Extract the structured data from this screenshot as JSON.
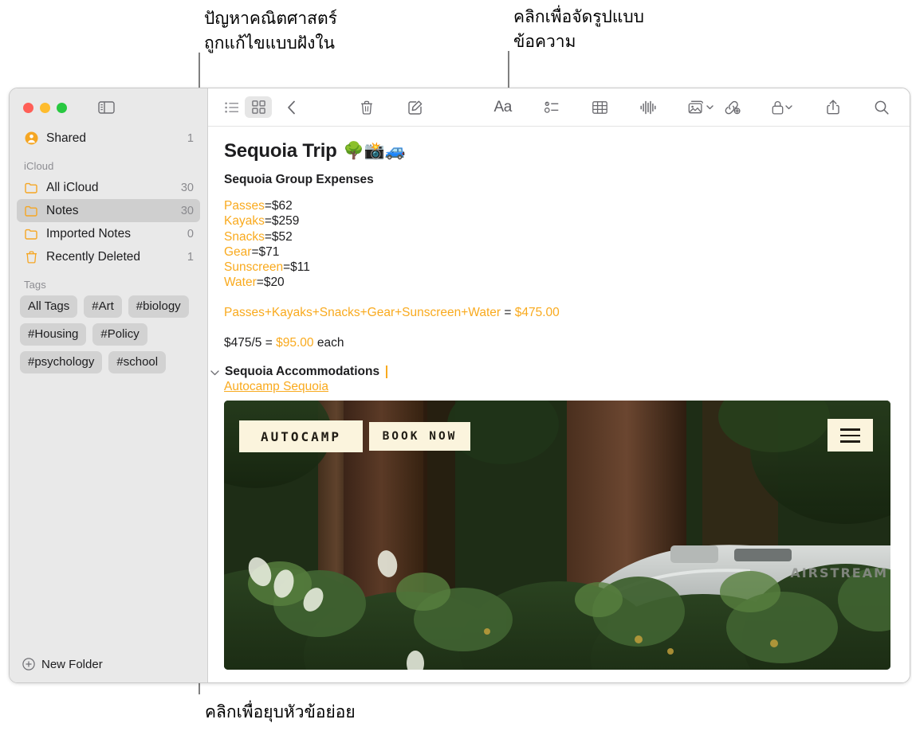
{
  "callouts": {
    "top_left": "ปัญหาคณิตศาสตร์\nถูกแก้ไขแบบฝังใน",
    "top_right": "คลิกเพื่อจัดรูปแบบ\nข้อความ",
    "bottom": "คลิกเพื่อยุบหัวข้อย่อย"
  },
  "sidebar": {
    "window_controls": [
      "close",
      "minimize",
      "zoom"
    ],
    "toggle_icon": "sidebar-toggle-icon",
    "shared": {
      "label": "Shared",
      "count": "1",
      "icon": "shared-person-icon"
    },
    "icloud_header": "iCloud",
    "folders": [
      {
        "label": "All iCloud",
        "count": "30",
        "icon": "folder-icon",
        "selected": false
      },
      {
        "label": "Notes",
        "count": "30",
        "icon": "folder-icon",
        "selected": true
      },
      {
        "label": "Imported Notes",
        "count": "0",
        "icon": "folder-icon",
        "selected": false
      },
      {
        "label": "Recently Deleted",
        "count": "1",
        "icon": "trash-icon",
        "selected": false
      }
    ],
    "tags_header": "Tags",
    "tags": [
      "All Tags",
      "#Art",
      "#biology",
      "#Housing",
      "#Policy",
      "#psychology",
      "#school"
    ],
    "new_folder": {
      "label": "New Folder",
      "icon": "plus-circle-icon"
    }
  },
  "toolbar": {
    "items": [
      {
        "name": "list-view-icon",
        "label": "List View"
      },
      {
        "name": "gallery-view-icon",
        "label": "Gallery View",
        "active": true
      },
      {
        "name": "back-chevron-icon",
        "label": "Back"
      },
      {
        "name": "trash-icon",
        "label": "Delete"
      },
      {
        "name": "compose-icon",
        "label": "New Note"
      },
      {
        "name": "format-aa-icon",
        "label": "Aa"
      },
      {
        "name": "checklist-icon",
        "label": "Checklist"
      },
      {
        "name": "table-icon",
        "label": "Table"
      },
      {
        "name": "audio-waveform-icon",
        "label": "Audio"
      },
      {
        "name": "media-icon",
        "label": "Media"
      },
      {
        "name": "link-icon",
        "label": "Add Link"
      },
      {
        "name": "lock-icon",
        "label": "Lock Note"
      },
      {
        "name": "share-icon",
        "label": "Share"
      },
      {
        "name": "search-icon",
        "label": "Search"
      }
    ],
    "aa_label": "Aa"
  },
  "note": {
    "title": "Sequoia Trip",
    "title_emoji": "🌳📸🚙",
    "subheading": "Sequoia Group Expenses",
    "expenses": [
      {
        "name": "Passes",
        "value": "=$62"
      },
      {
        "name": "Kayaks",
        "value": "=$259"
      },
      {
        "name": "Snacks",
        "value": "=$52"
      },
      {
        "name": "Gear",
        "value": "=$71"
      },
      {
        "name": "Sunscreen",
        "value": "=$11"
      },
      {
        "name": "Water",
        "value": "=$20"
      }
    ],
    "sum_expression": "Passes+Kayaks+Snacks+Gear+Sunscreen+Water",
    "sum_equals": " = ",
    "sum_result": "$475.00",
    "division_expr": "$475/5",
    "division_equals": " = ",
    "division_result": "$95.00",
    "division_suffix": " each",
    "collapsible_heading": "Sequoia Accommodations",
    "collapse_caret": "chevron-down-icon",
    "link_text": "Autocamp Sequoia"
  },
  "preview": {
    "logo_label": "AUTOCAMP",
    "book_label": "BOOK NOW",
    "menu_icon": "hamburger-menu-icon",
    "trailer_text": "AIRSTREAM"
  },
  "colors": {
    "accent_orange": "#f9aa1e",
    "selected_row": "#cfcfcf",
    "sidebar_bg": "#e9e9e9",
    "traffic_red": "#ff5f57",
    "traffic_yellow": "#febc2e",
    "traffic_green": "#28c840"
  }
}
